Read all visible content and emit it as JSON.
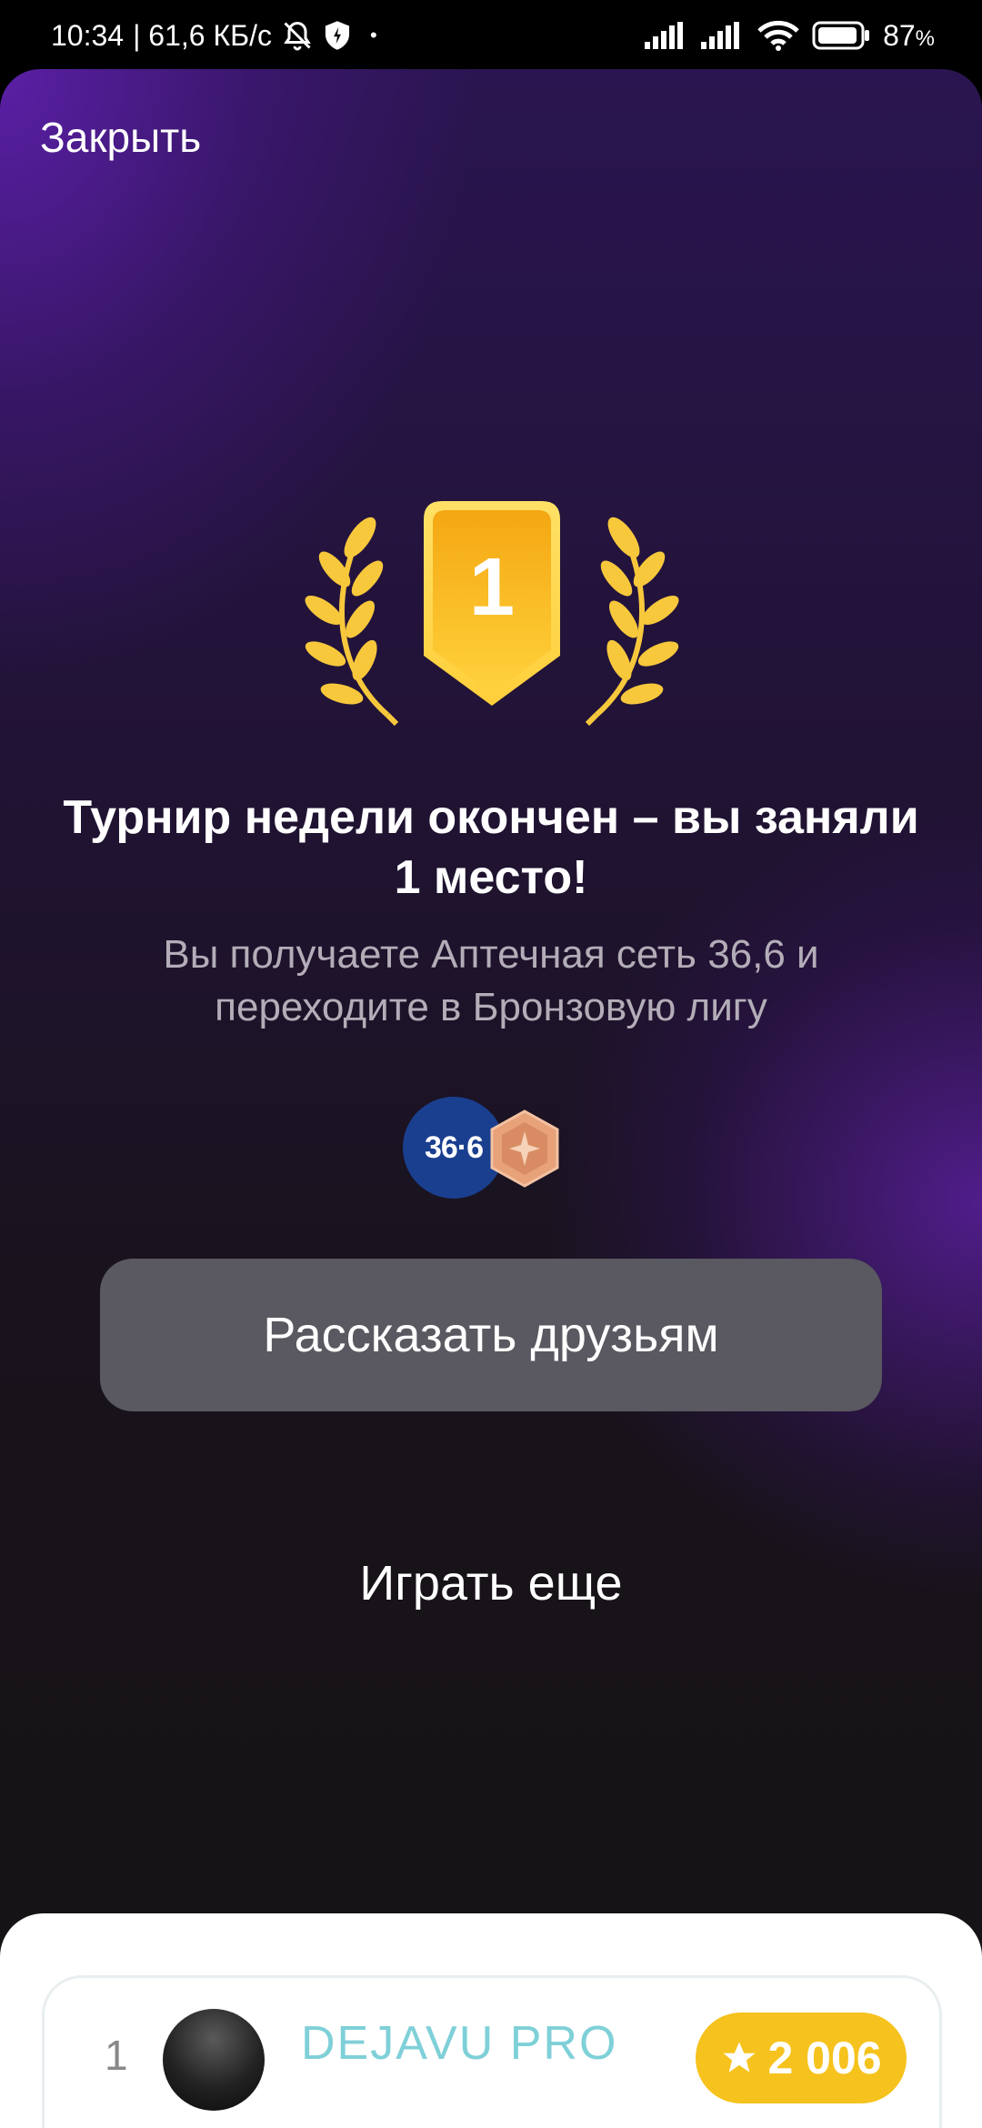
{
  "status_bar": {
    "time": "10:34",
    "net_speed": "| 61,6 КБ/с",
    "dot": "•",
    "battery": "87",
    "battery_unit": "%"
  },
  "header": {
    "close_label": "Закрыть"
  },
  "trophy": {
    "place_number": "1"
  },
  "result": {
    "title": "Турнир недели окончен – вы заняли 1 место!",
    "subtitle": "Вы получаете Аптечная сеть 36,6 и переходите в Бронзовую лигу"
  },
  "rewards": {
    "pharmacy_logo_text": "36·6"
  },
  "actions": {
    "share_label": "Рассказать друзьям",
    "play_again_label": "Играть еще"
  },
  "leaderboard": {
    "rows": [
      {
        "rank": "1",
        "name": "DEJAVU PRO",
        "score": "2 006"
      }
    ]
  },
  "colors": {
    "accent_purple": "#5d20aa",
    "trophy_gold": "#f5b51c",
    "laurel_gold": "#f7c83c",
    "score_pill": "#f6c21d",
    "username_teal": "#7fd0d8",
    "share_button_bg": "#5a5860"
  },
  "icons": {
    "notifications_off": "bell-off-icon",
    "vpn": "shield-icon",
    "signal": "signal-icon",
    "wifi": "wifi-icon",
    "battery": "battery-icon",
    "score_star": "star-icon",
    "league_badge": "bronze-league-icon"
  }
}
